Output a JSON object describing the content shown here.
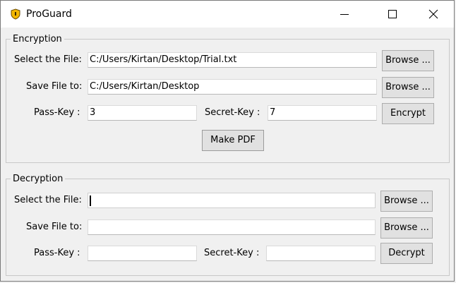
{
  "window": {
    "title": "ProGuard"
  },
  "encryption": {
    "legend": "Encryption",
    "select_label": "Select the File:",
    "select_value": "C:/Users/Kirtan/Desktop/Trial.txt",
    "browse1": "Browse ...",
    "save_label": "Save File to:",
    "save_value": "C:/Users/Kirtan/Desktop",
    "browse2": "Browse ...",
    "passkey_label": "Pass-Key :",
    "passkey_value": "3",
    "secretkey_label": "Secret-Key :",
    "secretkey_value": "7",
    "encrypt": "Encrypt",
    "make_pdf": "Make PDF"
  },
  "decryption": {
    "legend": "Decryption",
    "select_label": "Select the File:",
    "select_value": "",
    "browse1": "Browse ...",
    "save_label": "Save File to:",
    "save_value": "",
    "browse2": "Browse ...",
    "passkey_label": "Pass-Key :",
    "passkey_value": "",
    "secretkey_label": "Secret-Key :",
    "secretkey_value": "",
    "decrypt": "Decrypt"
  }
}
